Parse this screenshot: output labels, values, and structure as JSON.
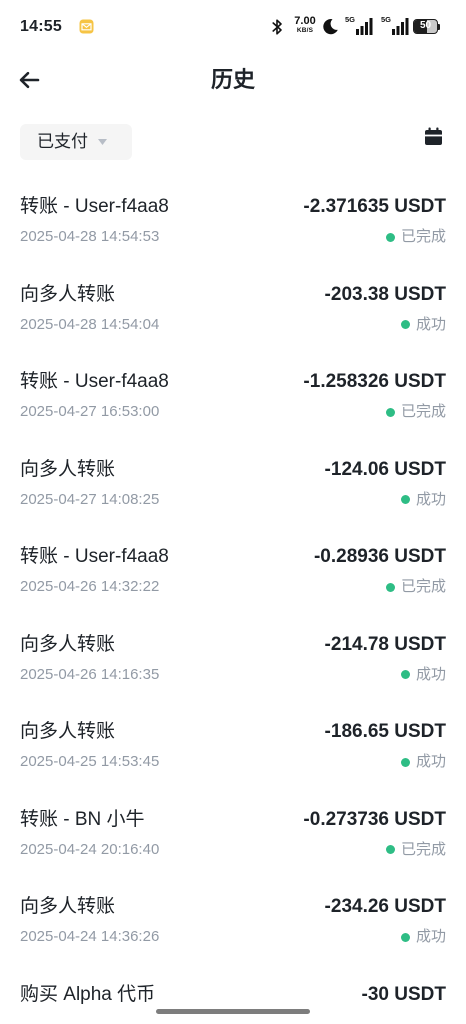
{
  "status_bar": {
    "time": "14:55",
    "notification_icon": "mail-notification-icon",
    "bluetooth_icon": "bluetooth-icon",
    "net_speed": {
      "value": "7.00",
      "unit": "KB/S"
    },
    "dnd_icon": "moon-icon",
    "signal_1": {
      "label": "5G",
      "icon": "cell-signal-icon"
    },
    "signal_2": {
      "label": "5G",
      "icon": "cell-signal-icon"
    },
    "battery": {
      "level": "50",
      "icon": "battery-icon"
    }
  },
  "header": {
    "title": "历史",
    "back_icon": "arrow-left-icon"
  },
  "filter": {
    "selected_status": "已支付",
    "dropdown_icon": "caret-down-icon",
    "calendar_icon": "calendar-icon"
  },
  "transactions": [
    {
      "title": "转账 - User-f4aa8",
      "time": "2025-04-28 14:54:53",
      "amount": "-2.371635 USDT",
      "status": "已完成"
    },
    {
      "title": "向多人转账",
      "time": "2025-04-28 14:54:04",
      "amount": "-203.38 USDT",
      "status": "成功"
    },
    {
      "title": "转账 - User-f4aa8",
      "time": "2025-04-27 16:53:00",
      "amount": "-1.258326 USDT",
      "status": "已完成"
    },
    {
      "title": "向多人转账",
      "time": "2025-04-27 14:08:25",
      "amount": "-124.06 USDT",
      "status": "成功"
    },
    {
      "title": "转账 - User-f4aa8",
      "time": "2025-04-26 14:32:22",
      "amount": "-0.28936 USDT",
      "status": "已完成"
    },
    {
      "title": "向多人转账",
      "time": "2025-04-26 14:16:35",
      "amount": "-214.78 USDT",
      "status": "成功"
    },
    {
      "title": "向多人转账",
      "time": "2025-04-25 14:53:45",
      "amount": "-186.65 USDT",
      "status": "成功"
    },
    {
      "title": "转账 - BN 小牛",
      "time": "2025-04-24 20:16:40",
      "amount": "-0.273736 USDT",
      "status": "已完成"
    },
    {
      "title": "向多人转账",
      "time": "2025-04-24 14:36:26",
      "amount": "-234.26 USDT",
      "status": "成功"
    },
    {
      "title": "购买 Alpha 代币",
      "amount": "-30 USDT"
    }
  ],
  "colors": {
    "text_primary": "#1e2329",
    "text_secondary": "#929aa5",
    "status_success": "#2ebd85",
    "chip_background": "#f5f5f5",
    "notification_yellow": "#f6c445"
  }
}
